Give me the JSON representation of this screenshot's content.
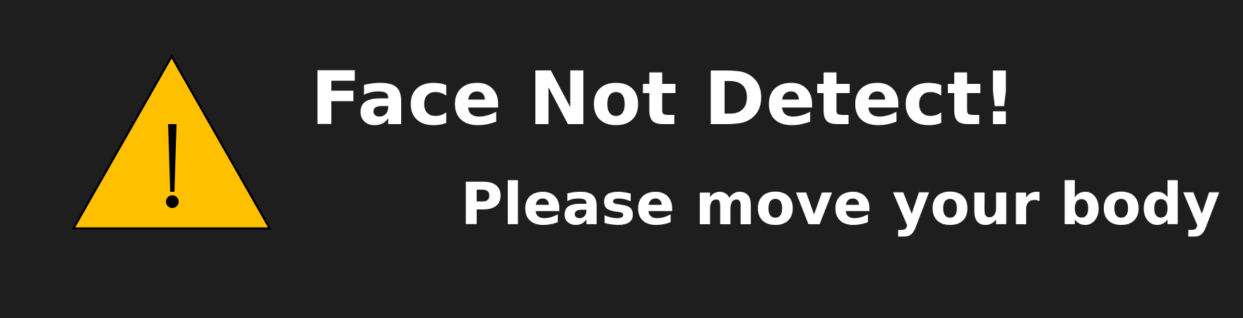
{
  "alert": {
    "icon": "warning-icon",
    "title": "Face Not Detect!",
    "message": "Please move your body"
  },
  "colors": {
    "background": "#1e1e1e",
    "warning_fill": "#ffc000",
    "warning_stroke": "#000000",
    "text": "#ffffff"
  }
}
